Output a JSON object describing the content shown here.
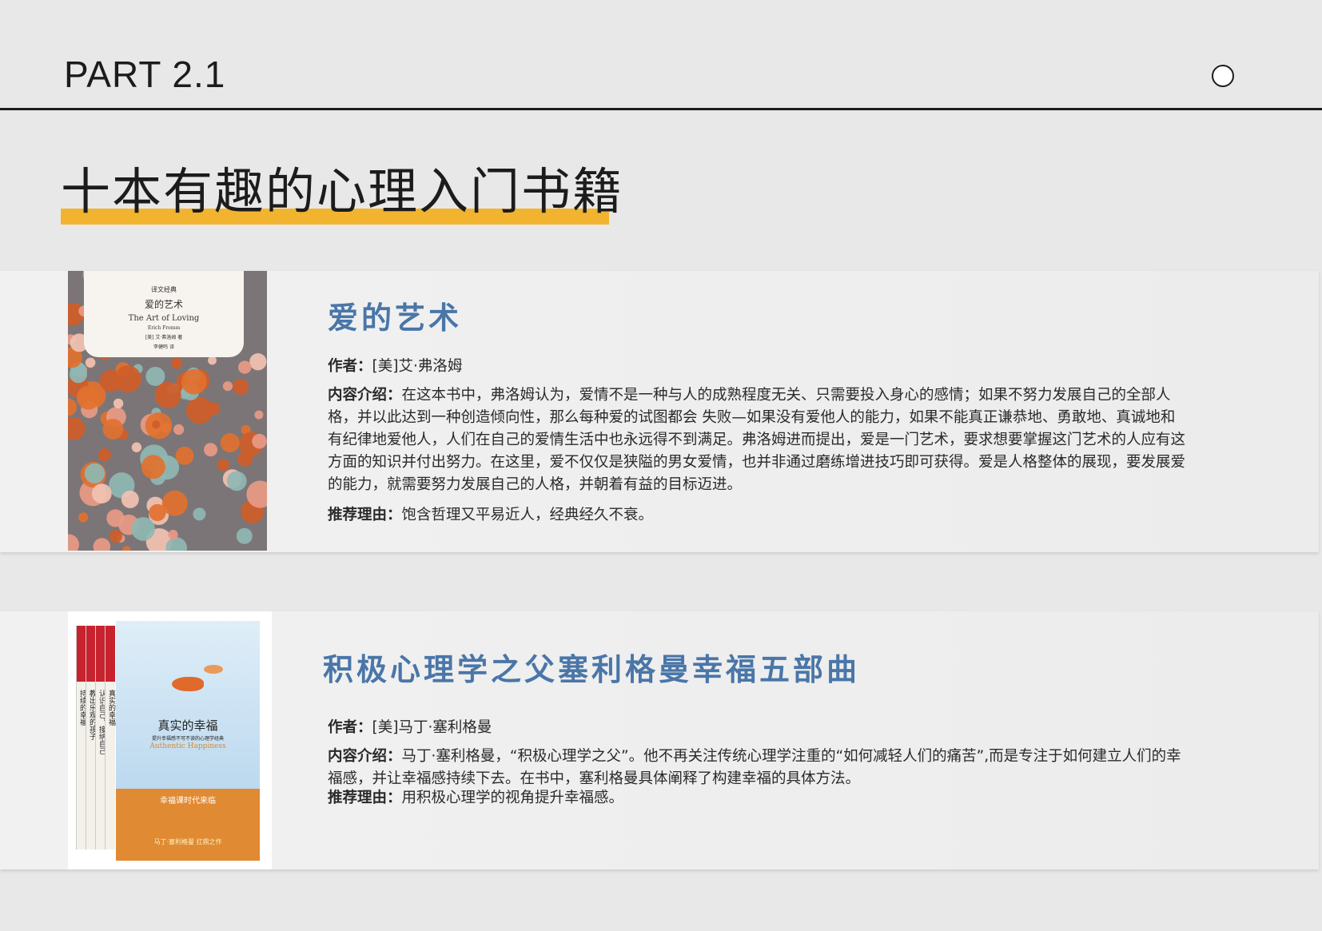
{
  "header": {
    "part_label": "PART 2.1"
  },
  "section_title": "十本有趣的心理入门书籍",
  "books": [
    {
      "title": "爱的艺术",
      "author_label": "作者：",
      "author": "[美]艾·弗洛姆",
      "intro_label": "内容介绍：",
      "intro": "在这本书中，弗洛姆认为，爱情不是一种与人的成熟程度无关、只需要投入身心的感情；如果不努力发展自己的全部人格，并以此达到一种创造倾向性，那么每种爱的试图都会 失败—如果没有爱他人的能力，如果不能真正谦恭地、勇敢地、真诚地和有纪律地爱他人，人们在自己的爱情生活中也永远得不到满足。弗洛姆进而提出，爱是一门艺术，要求想要掌握这门艺术的人应有这方面的知识并付出努力。在这里，爱不仅仅是狭隘的男女爱情，也并非通过磨练增进技巧即可获得。爱是人格整体的展现，要发展爱的能力，就需要努力发展自己的人格，并朝着有益的目标迈进。",
      "reason_label": "推荐理由：",
      "reason": "饱含哲理又平易近人，经典经久不衰。",
      "cover": {
        "series": "译文经典",
        "title_cn": "爱的艺术",
        "title_en": "The Art of Loving",
        "author_en": "Erich Fromm",
        "author_cn": "[美] 艾·弗洛姆 著",
        "translator": "李健鸣 译"
      }
    },
    {
      "title": "积极心理学之父塞利格曼幸福五部曲",
      "author_label": "作者：",
      "author": "[美]马丁·塞利格曼",
      "intro_label": "内容介绍：",
      "intro": "马丁·塞利格曼，“积极心理学之父”。他不再关注传统心理学注重的“如何减轻人们的痛苦”,而是专注于如何建立人们的幸福感，并让幸福感持续下去。在书中，塞利格曼具体阐释了构建幸福的具体方法。",
      "reason_label": "推荐理由：",
      "reason": "用积极心理学的视角提升幸福感。",
      "cover": {
        "spines": [
          "持续的幸福",
          "教出乐观的孩子",
          "认识自己，接纳自己",
          "真实的幸福"
        ],
        "title_cn": "真实的幸福",
        "subtitle": "提升幸福感不可不读的心理学经典",
        "title_en": "Authentic Happiness",
        "band_text": "幸福课时代来临",
        "band_note": "马丁·塞利格曼 扛鼎之作"
      }
    }
  ],
  "colors": {
    "title_blue": "#4a76a8",
    "highlight": "#f2b42e",
    "background": "#e8e8e8"
  }
}
